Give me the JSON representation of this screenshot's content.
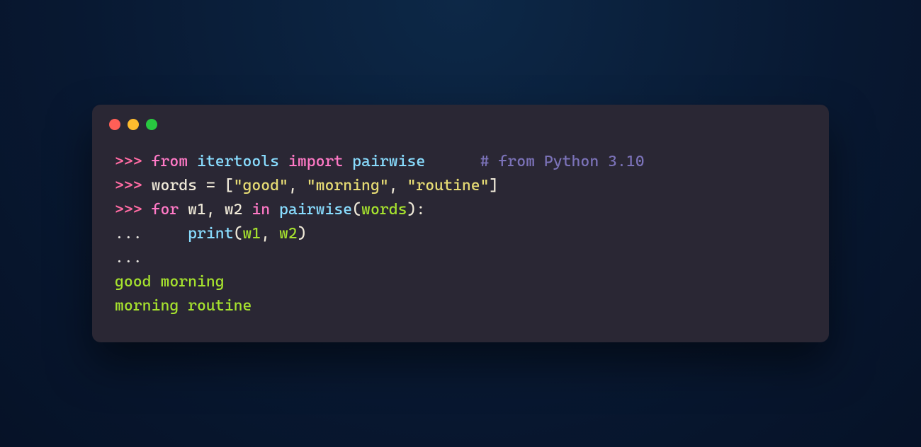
{
  "colors": {
    "bg": "#081831",
    "terminal": "#2a2734",
    "red": "#ff5f57",
    "yellow": "#febc2e",
    "green": "#28c840"
  },
  "lines": [
    {
      "tokens": [
        {
          "cls": "tok-prompt",
          "t": ">>> "
        },
        {
          "cls": "tok-keyword",
          "t": "from"
        },
        {
          "cls": "tok-default",
          "t": " "
        },
        {
          "cls": "tok-module",
          "t": "itertools"
        },
        {
          "cls": "tok-default",
          "t": " "
        },
        {
          "cls": "tok-keyword",
          "t": "import"
        },
        {
          "cls": "tok-default",
          "t": " "
        },
        {
          "cls": "tok-module",
          "t": "pairwise"
        },
        {
          "cls": "tok-default",
          "t": "      "
        },
        {
          "cls": "tok-comment",
          "t": "# from Python 3.10"
        }
      ]
    },
    {
      "tokens": [
        {
          "cls": "tok-prompt",
          "t": ">>> "
        },
        {
          "cls": "tok-default",
          "t": "words "
        },
        {
          "cls": "tok-operator",
          "t": "="
        },
        {
          "cls": "tok-default",
          "t": " ["
        },
        {
          "cls": "tok-string",
          "t": "\"good\""
        },
        {
          "cls": "tok-default",
          "t": ", "
        },
        {
          "cls": "tok-string",
          "t": "\"morning\""
        },
        {
          "cls": "tok-default",
          "t": ", "
        },
        {
          "cls": "tok-string",
          "t": "\"routine\""
        },
        {
          "cls": "tok-default",
          "t": "]"
        }
      ]
    },
    {
      "tokens": [
        {
          "cls": "tok-prompt",
          "t": ">>> "
        },
        {
          "cls": "tok-keyword",
          "t": "for"
        },
        {
          "cls": "tok-default",
          "t": " w1, w2 "
        },
        {
          "cls": "tok-keyword",
          "t": "in"
        },
        {
          "cls": "tok-default",
          "t": " "
        },
        {
          "cls": "tok-func",
          "t": "pairwise"
        },
        {
          "cls": "tok-default",
          "t": "("
        },
        {
          "cls": "tok-args",
          "t": "words"
        },
        {
          "cls": "tok-default",
          "t": "):"
        }
      ]
    },
    {
      "tokens": [
        {
          "cls": "tok-cont",
          "t": "... "
        },
        {
          "cls": "tok-default",
          "t": "    "
        },
        {
          "cls": "tok-func",
          "t": "print"
        },
        {
          "cls": "tok-default",
          "t": "("
        },
        {
          "cls": "tok-args",
          "t": "w1"
        },
        {
          "cls": "tok-default",
          "t": ", "
        },
        {
          "cls": "tok-args",
          "t": "w2"
        },
        {
          "cls": "tok-default",
          "t": ")"
        }
      ]
    },
    {
      "tokens": [
        {
          "cls": "tok-cont",
          "t": "... "
        }
      ]
    },
    {
      "tokens": [
        {
          "cls": "tok-output",
          "t": "good morning"
        }
      ]
    },
    {
      "tokens": [
        {
          "cls": "tok-output",
          "t": "morning routine"
        }
      ]
    }
  ]
}
